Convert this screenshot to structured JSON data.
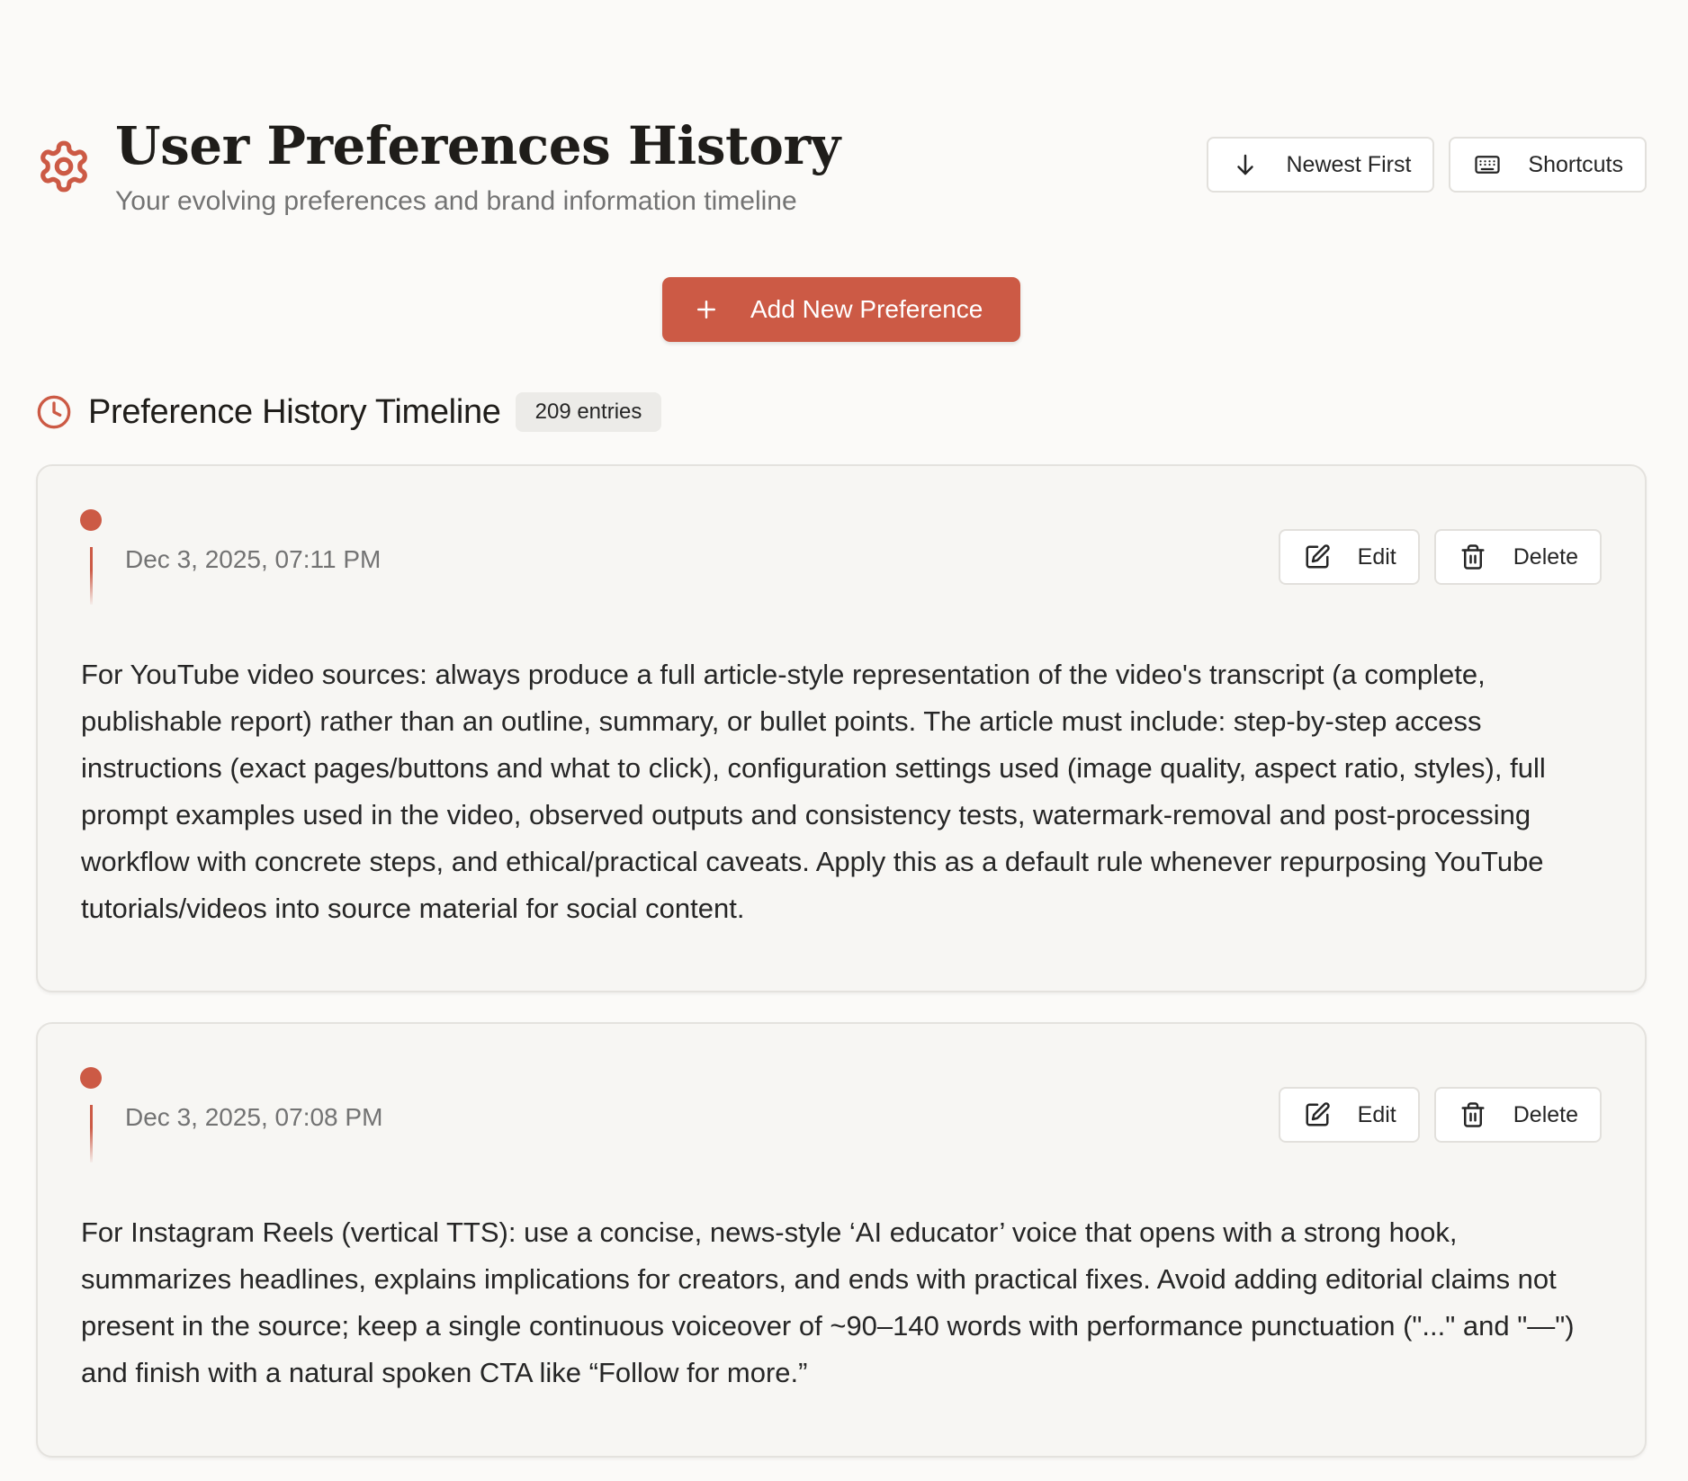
{
  "header": {
    "title": "User Preferences History",
    "subtitle": "Your evolving preferences and brand information timeline",
    "sort_label": "Newest First",
    "shortcuts_label": "Shortcuts"
  },
  "actions": {
    "add_label": "Add New Preference"
  },
  "timeline": {
    "title": "Preference History Timeline",
    "count_label": "209 entries"
  },
  "entries": [
    {
      "date": "Dec 3, 2025, 07:11 PM",
      "edit_label": "Edit",
      "delete_label": "Delete",
      "text": "For YouTube video sources: always produce a full article-style representation of the video's transcript (a complete, publishable report) rather than an outline, summary, or bullet points. The article must include: step-by-step access instructions (exact pages/buttons and what to click), configuration settings used (image quality, aspect ratio, styles), full prompt examples used in the video, observed outputs and consistency tests, watermark-removal and post-processing workflow with concrete steps, and ethical/practical caveats. Apply this as a default rule whenever repurposing YouTube tutorials/videos into source material for social content."
    },
    {
      "date": "Dec 3, 2025, 07:08 PM",
      "edit_label": "Edit",
      "delete_label": "Delete",
      "text": "For Instagram Reels (vertical TTS): use a concise, news-style ‘AI educator’ voice that opens with a strong hook, summarizes headlines, explains implications for creators, and ends with practical fixes. Avoid adding editorial claims not present in the source; keep a single continuous voiceover of ~90–140 words with performance punctuation (\"...\" and \"—\") and finish with a natural spoken CTA like “Follow for more.”"
    }
  ],
  "icons": {
    "header": "gear-icon",
    "sort": "arrow-down-icon",
    "shortcuts": "keyboard-icon",
    "add": "plus-icon",
    "timeline": "clock-icon",
    "edit": "edit-icon",
    "delete": "trash-icon"
  },
  "colors": {
    "accent": "#cc5a45",
    "background": "#fbfaf8",
    "card": "#f7f6f3",
    "muted_text": "#737373",
    "badge": "#ecebe8"
  }
}
